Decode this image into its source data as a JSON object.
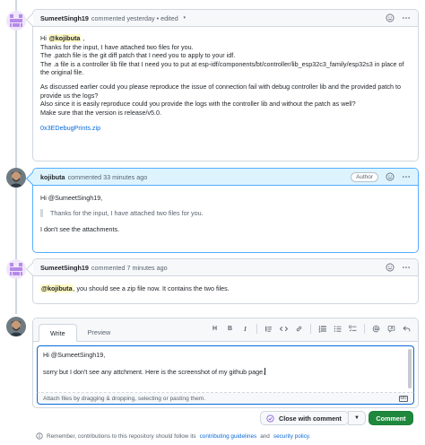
{
  "comments": [
    {
      "author": "SumeetSingh19",
      "meta": "commented yesterday • edited",
      "has_edit_dropdown": true,
      "body": {
        "greeting_prefix": "Hi",
        "greeting_mention": "@kojibuta",
        "greeting_suffix": ",",
        "line_1": "Thanks for the input, I have attached two files for you.",
        "line_2": "The .patch file is the git diff patch that I need you to apply to your idf.",
        "line_3": "The .a file is a controller lib file that I need you to put at esp-idf/components/bt/controller/lib_esp32c3_family/esp32s3 in place of the original file.",
        "para_2_line_1": "As discussed earlier could you please reproduce the issue of connection fail with debug controller lib and the provided patch to provide us the logs?",
        "para_2_line_2": "Also since it is easily reproduce could you provide the logs with the controller lib and without the patch as well?",
        "para_2_line_3": "Make sure that the version is release/v5.0.",
        "attachment_link": "0x3EDebugPrints.zip"
      }
    },
    {
      "author": "kojibuta",
      "meta": "commented 33 minutes ago",
      "role_badge": "Author",
      "body": {
        "greeting": "Hi @SumeetSingh19,",
        "quote": "Thanks for the input, I have attached two files for you.",
        "text": "I don't see the attachments."
      }
    },
    {
      "author": "SumeetSingh19",
      "meta": "commented 7 minutes ago",
      "body": {
        "mention": "@kojibuta",
        "text": ", you should see a zip file now. It contains the two files."
      }
    }
  ],
  "editor": {
    "tabs": [
      {
        "label": "Write",
        "active": true
      },
      {
        "label": "Preview",
        "active": false
      }
    ],
    "toolbar": [
      "heading-icon",
      "bold-icon",
      "italic-icon",
      "quote-icon",
      "code-icon",
      "link-icon",
      "ordered-list-icon",
      "unordered-list-icon",
      "task-list-icon",
      "mention-icon",
      "cross-reference-icon",
      "reply-icon"
    ],
    "toolbar_labels": {
      "heading": "H",
      "bold": "B",
      "italic": "I"
    },
    "text_line_1": "Hi @SumeetSingh19,",
    "text_line_2": "sorry but I don't see any attchment. Here is the screenshot of my github page.",
    "attach_hint": "Attach files by dragging & dropping, selecting or pasting them.",
    "markdown_badge": "MD"
  },
  "actions": {
    "close_with_comment": "Close with comment",
    "comment": "Comment"
  },
  "footer": {
    "prefix": "Remember, contributions to this repository should follow its",
    "guidelines_link": "contributing guidelines",
    "and": "and",
    "policy_link": "security policy",
    "suffix": "."
  },
  "colors": {
    "accent": "#0969da",
    "primary_button": "#1f883d",
    "mention_highlight": "#fff8c5",
    "author_header": "#ddf4ff"
  }
}
